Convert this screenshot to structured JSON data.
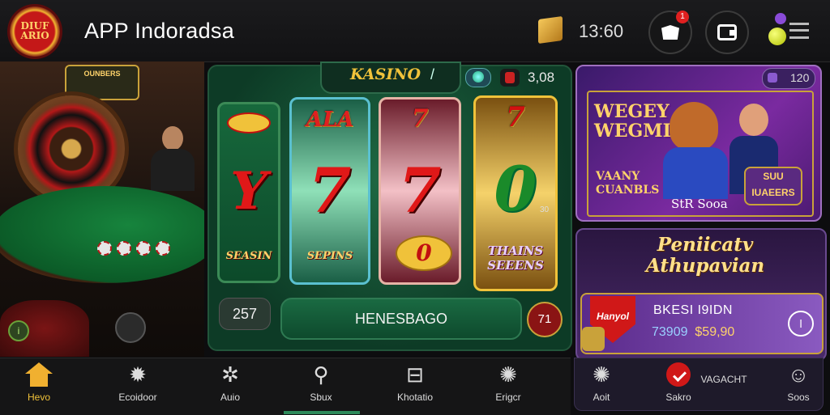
{
  "header": {
    "logo_text": "DIUF ARIO",
    "title": "APP Indoradsa",
    "balance": "13:60",
    "notification_count": "1"
  },
  "left_panel": {
    "sign_text": "OUNBERS",
    "coin_label": "i"
  },
  "slot": {
    "name": "KASINO",
    "arrow": "/",
    "credit": "3,08",
    "reels": [
      {
        "top": "",
        "mid": "Y",
        "bot": "SEASIN"
      },
      {
        "top": "ALA",
        "mid": "7",
        "bot": "SEPINS"
      },
      {
        "top": "7",
        "mid": "7",
        "bot": "0"
      },
      {
        "top": "7",
        "mid": "0",
        "bot": "THAINS SEEENS"
      }
    ],
    "side_value": "30",
    "bet": "257",
    "spin_label": "HENESBAGO",
    "round_button": "71"
  },
  "promo_top": {
    "badge_value": "120",
    "title": "WEGEY WEGMIS",
    "subtitle": "VAANY CUANBLS",
    "caption": "StR Sooa",
    "button": "SUU IUAEERS"
  },
  "promo_bottom": {
    "title": "Peniicatv Athupavian",
    "shield_text": "Hanyol",
    "label": "BKESI I9IDN",
    "amount_a": "73909",
    "amount_b": "$59,90",
    "circle": "l"
  },
  "bottom_nav": {
    "items": [
      {
        "label": "Hevo",
        "icon": "home-icon",
        "active": true
      },
      {
        "label": "Ecoidoor",
        "icon": "gear-icon"
      },
      {
        "label": "Auio",
        "icon": "settings-icon"
      },
      {
        "label": "Sbux",
        "icon": "search-icon"
      },
      {
        "label": "Khotatio",
        "icon": "export-icon"
      },
      {
        "label": "Erigcr",
        "icon": "globe-icon"
      }
    ],
    "secondary": [
      {
        "label": "Aoit",
        "icon": "settings-icon"
      },
      {
        "label": "Sakro",
        "icon": "play-icon"
      },
      {
        "label": "VAGACHT",
        "icon": "text"
      },
      {
        "label": "Soos",
        "icon": "user-icon"
      }
    ]
  },
  "colors": {
    "accent": "#f0c23a",
    "felt": "#17843d",
    "promo_purple": "#7a2aa0"
  }
}
